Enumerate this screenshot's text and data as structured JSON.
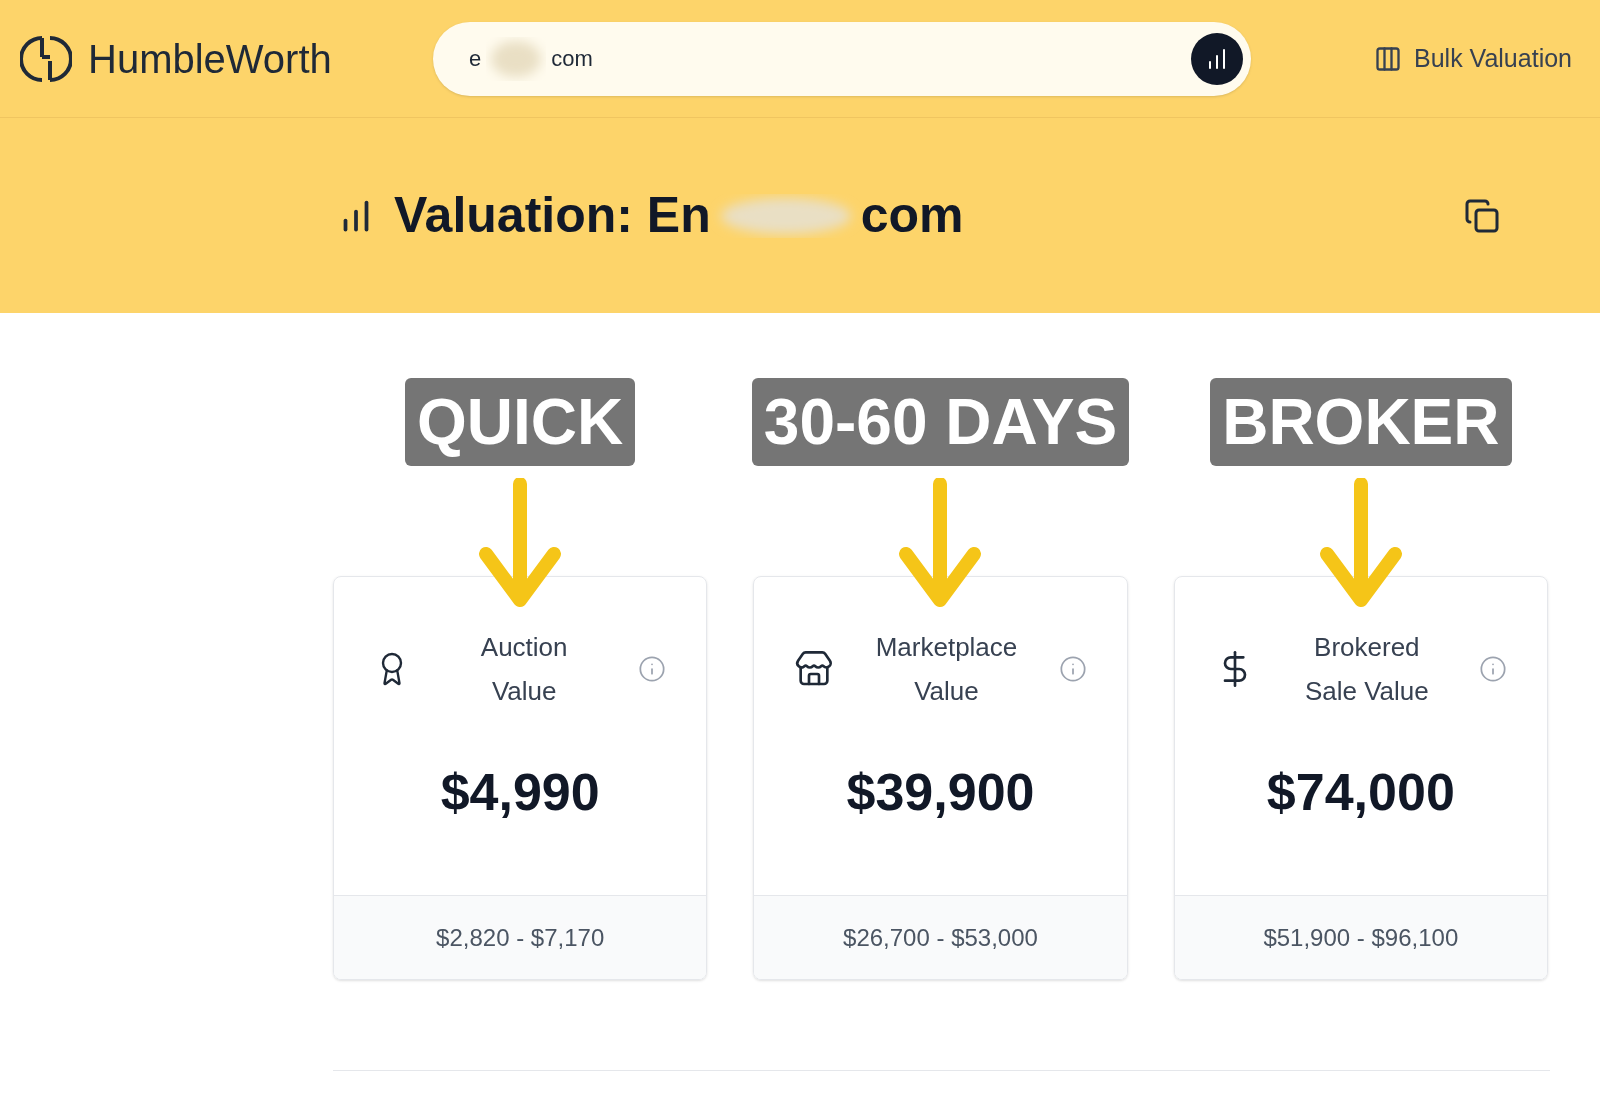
{
  "header": {
    "logo": "HumbleWorth",
    "search": {
      "value_start": "e",
      "value_end": "com"
    },
    "bulk_button": "Bulk Valuation"
  },
  "title": {
    "prefix": "Valuation: En",
    "suffix": "com"
  },
  "annotations": [
    "QUICK",
    "30-60 DAYS",
    "BROKER"
  ],
  "cards": [
    {
      "kind": "auction",
      "title_lines": [
        "Auction",
        "Value"
      ],
      "value": "$4,990",
      "range": "$2,820 - $7,170"
    },
    {
      "kind": "marketplace",
      "title_lines": [
        "Marketplace",
        "Value"
      ],
      "value": "$39,900",
      "range": "$26,700 - $53,000"
    },
    {
      "kind": "brokered",
      "title_lines": [
        "Brokered",
        "Sale Value"
      ],
      "value": "$74,000",
      "range": "$51,900 - $96,100"
    }
  ]
}
